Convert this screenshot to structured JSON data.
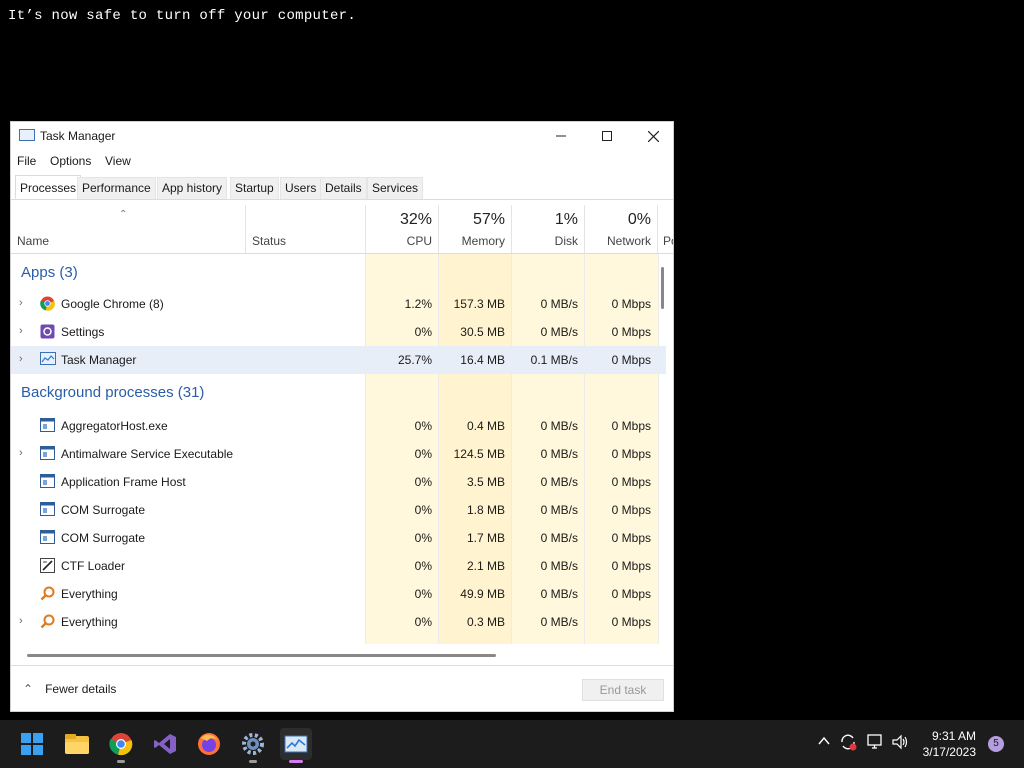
{
  "console": {
    "message": "It’s now safe to turn off your computer."
  },
  "window": {
    "title": "Task Manager"
  },
  "menu": [
    "File",
    "Options",
    "View"
  ],
  "tabs": [
    "Processes",
    "Performance",
    "App history",
    "Startup",
    "Users",
    "Details",
    "Services"
  ],
  "columns": {
    "name": "Name",
    "status": "Status",
    "cpu": {
      "pct": "32%",
      "label": "CPU"
    },
    "memory": {
      "pct": "57%",
      "label": "Memory"
    },
    "disk": {
      "pct": "1%",
      "label": "Disk"
    },
    "network": {
      "pct": "0%",
      "label": "Network"
    },
    "power_partial": "Po"
  },
  "groups": {
    "apps": "Apps (3)",
    "background": "Background processes (31)"
  },
  "apps": [
    {
      "name": "Google Chrome (8)",
      "cpu": "1.2%",
      "memory": "157.3 MB",
      "disk": "0 MB/s",
      "network": "0 Mbps",
      "icon": "chrome-icon",
      "expandable": true
    },
    {
      "name": "Settings",
      "cpu": "0%",
      "memory": "30.5 MB",
      "disk": "0 MB/s",
      "network": "0 Mbps",
      "icon": "settings-icon",
      "expandable": true
    },
    {
      "name": "Task Manager",
      "cpu": "25.7%",
      "memory": "16.4 MB",
      "disk": "0.1 MB/s",
      "network": "0 Mbps",
      "icon": "task-manager-icon",
      "expandable": true,
      "selected": true
    }
  ],
  "background": [
    {
      "name": "AggregatorHost.exe",
      "cpu": "0%",
      "memory": "0.4 MB",
      "disk": "0 MB/s",
      "network": "0 Mbps",
      "icon": "app-window-icon",
      "expandable": false
    },
    {
      "name": "Antimalware Service Executable",
      "cpu": "0%",
      "memory": "124.5 MB",
      "disk": "0 MB/s",
      "network": "0 Mbps",
      "icon": "app-window-icon",
      "expandable": true
    },
    {
      "name": "Application Frame Host",
      "cpu": "0%",
      "memory": "3.5 MB",
      "disk": "0 MB/s",
      "network": "0 Mbps",
      "icon": "app-window-icon",
      "expandable": false
    },
    {
      "name": "COM Surrogate",
      "cpu": "0%",
      "memory": "1.8 MB",
      "disk": "0 MB/s",
      "network": "0 Mbps",
      "icon": "app-window-icon",
      "expandable": false
    },
    {
      "name": "COM Surrogate",
      "cpu": "0%",
      "memory": "1.7 MB",
      "disk": "0 MB/s",
      "network": "0 Mbps",
      "icon": "app-window-icon",
      "expandable": false
    },
    {
      "name": "CTF Loader",
      "cpu": "0%",
      "memory": "2.1 MB",
      "disk": "0 MB/s",
      "network": "0 Mbps",
      "icon": "ctf-loader-icon",
      "expandable": false
    },
    {
      "name": "Everything",
      "cpu": "0%",
      "memory": "49.9 MB",
      "disk": "0 MB/s",
      "network": "0 Mbps",
      "icon": "everything-search-icon",
      "expandable": false
    },
    {
      "name": "Everything",
      "cpu": "0%",
      "memory": "0.3 MB",
      "disk": "0 MB/s",
      "network": "0 Mbps",
      "icon": "everything-search-icon",
      "expandable": true
    }
  ],
  "footer": {
    "fewer_details": "Fewer details",
    "end_task": "End task"
  },
  "taskbar": {
    "apps": [
      "start-icon",
      "file-explorer-icon",
      "chrome-icon",
      "visual-studio-icon",
      "firefox-icon",
      "settings-icon",
      "task-manager-icon"
    ],
    "time": "9:31 AM",
    "date": "3/17/2023",
    "notifications": "5"
  },
  "colors": {
    "heat_light": "#fff8dc",
    "heat_mid": "#fff0c2",
    "heat_strong": "#ffe7a6",
    "link_blue": "#2a5da8",
    "accent": "#d77af1"
  }
}
